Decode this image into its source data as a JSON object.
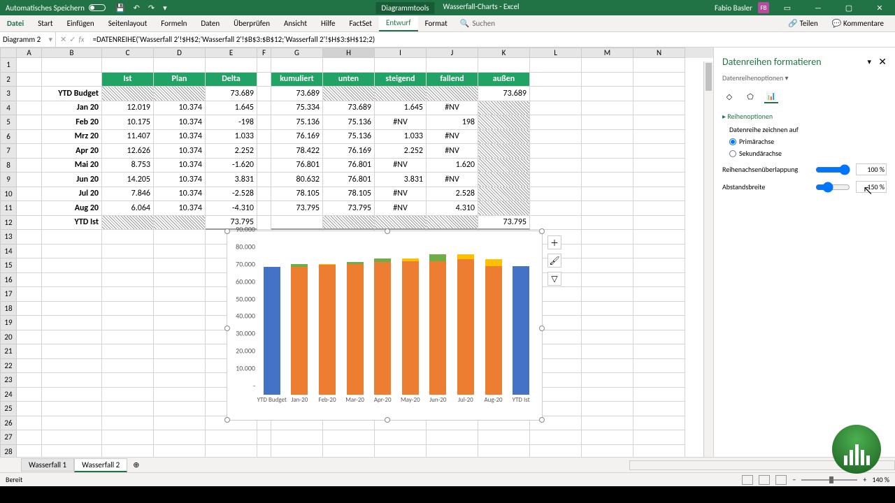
{
  "titlebar": {
    "autosave": "Automatisches Speichern",
    "tool_context": "Diagrammtools",
    "doc_title": "Wasserfall-Charts - Excel",
    "user_name": "Fabio Basler",
    "user_initials": "FB"
  },
  "ribbon": {
    "tabs": [
      "Datei",
      "Start",
      "Einfügen",
      "Seitenlayout",
      "Formeln",
      "Daten",
      "Überprüfen",
      "Ansicht",
      "Hilfe",
      "FactSet",
      "Entwurf",
      "Format"
    ],
    "active_tab": "Entwurf",
    "search_placeholder": "Suchen",
    "share": "Teilen",
    "comments": "Kommentare"
  },
  "formula_bar": {
    "name_box": "Diagramm 2",
    "formula": "=DATENREIHE('Wasserfall 2'!$H$2;'Wasserfall 2'!$B$3:$B$12;'Wasserfall 2'!$H$3:$H$12;2)"
  },
  "columns": [
    "A",
    "B",
    "C",
    "D",
    "E",
    "F",
    "G",
    "H",
    "I",
    "J",
    "K",
    "L",
    "M",
    "N"
  ],
  "headers1": {
    "C": "Ist",
    "D": "Plan",
    "E": "Delta",
    "G": "kumuliert",
    "H": "unten",
    "I": "steigend",
    "J": "fallend",
    "K": "außen"
  },
  "rows": [
    {
      "n": 3,
      "B": "YTD Budget",
      "E": "73.689",
      "G": "73.689",
      "K": "73.689"
    },
    {
      "n": 4,
      "B": "Jan 20",
      "C": "12.019",
      "D": "10.374",
      "E": "1.645",
      "G": "75.334",
      "H": "73.689",
      "I": "1.645",
      "J": "#NV"
    },
    {
      "n": 5,
      "B": "Feb 20",
      "C": "10.175",
      "D": "10.374",
      "E": "-198",
      "G": "75.136",
      "H": "75.136",
      "I": "#NV",
      "J": "198"
    },
    {
      "n": 6,
      "B": "Mrz 20",
      "C": "11.407",
      "D": "10.374",
      "E": "1.033",
      "G": "76.169",
      "H": "75.136",
      "I": "1.033",
      "J": "#NV"
    },
    {
      "n": 7,
      "B": "Apr 20",
      "C": "12.626",
      "D": "10.374",
      "E": "2.252",
      "G": "78.422",
      "H": "76.169",
      "I": "2.252",
      "J": "#NV"
    },
    {
      "n": 8,
      "B": "Mai 20",
      "C": "8.753",
      "D": "10.374",
      "E": "-1.620",
      "G": "76.801",
      "H": "76.801",
      "I": "#NV",
      "J": "1.620"
    },
    {
      "n": 9,
      "B": "Jun 20",
      "C": "14.205",
      "D": "10.374",
      "E": "3.831",
      "G": "80.632",
      "H": "76.801",
      "I": "3.831",
      "J": "#NV"
    },
    {
      "n": 10,
      "B": "Jul 20",
      "C": "7.846",
      "D": "10.374",
      "E": "-2.528",
      "G": "78.105",
      "H": "78.105",
      "I": "#NV",
      "J": "2.528"
    },
    {
      "n": 11,
      "B": "Aug 20",
      "C": "6.064",
      "D": "10.374",
      "E": "-4.310",
      "G": "73.795",
      "H": "73.795",
      "I": "#NV",
      "J": "4.310"
    },
    {
      "n": 12,
      "B": "YTD Ist",
      "E": "73.795",
      "K": "73.795"
    }
  ],
  "chart_data": {
    "type": "bar",
    "categories": [
      "YTD Budget",
      "Jan-20",
      "Feb-20",
      "Mar-20",
      "Apr-20",
      "May-20",
      "Jun-20",
      "Jul-20",
      "Aug-20",
      "YTD Ist"
    ],
    "ylim": [
      0,
      90000
    ],
    "yticks": [
      0,
      10000,
      20000,
      30000,
      40000,
      50000,
      60000,
      70000,
      80000,
      90000
    ],
    "ytick_labels": [
      "-",
      "10.000",
      "20.000",
      "30.000",
      "40.000",
      "50.000",
      "60.000",
      "70.000",
      "80.000",
      "90.000"
    ],
    "series": [
      {
        "name": "außen",
        "color": "#4472c4",
        "values": [
          73689,
          null,
          null,
          null,
          null,
          null,
          null,
          null,
          null,
          73795
        ]
      },
      {
        "name": "unten",
        "color": "#ed7d31",
        "values": [
          null,
          73689,
          75136,
          75136,
          76169,
          76801,
          76801,
          78105,
          73795,
          null
        ]
      },
      {
        "name": "steigend",
        "color": "#70ad47",
        "values": [
          null,
          1645,
          null,
          1033,
          2252,
          null,
          3831,
          null,
          null,
          null
        ]
      },
      {
        "name": "fallend",
        "color": "#ffc000",
        "values": [
          null,
          null,
          198,
          null,
          null,
          1620,
          null,
          2528,
          4310,
          null
        ]
      }
    ]
  },
  "side_panel": {
    "title": "Datenreihen formatieren",
    "subtitle": "Datenreihenoptionen",
    "section": "Reihenoptionen",
    "plot_on": "Datenreihe zeichnen auf",
    "primary": "Primärachse",
    "secondary": "Sekundärachse",
    "overlap_label": "Reihenachsenüberlappung",
    "overlap_value": "100 %",
    "gap_label": "Abstandsbreite",
    "gap_value": "150 %"
  },
  "sheets": {
    "tabs": [
      "Wasserfall 1",
      "Wasserfall 2"
    ],
    "active": "Wasserfall 2"
  },
  "status": {
    "ready": "Bereit",
    "zoom": "140 %"
  }
}
